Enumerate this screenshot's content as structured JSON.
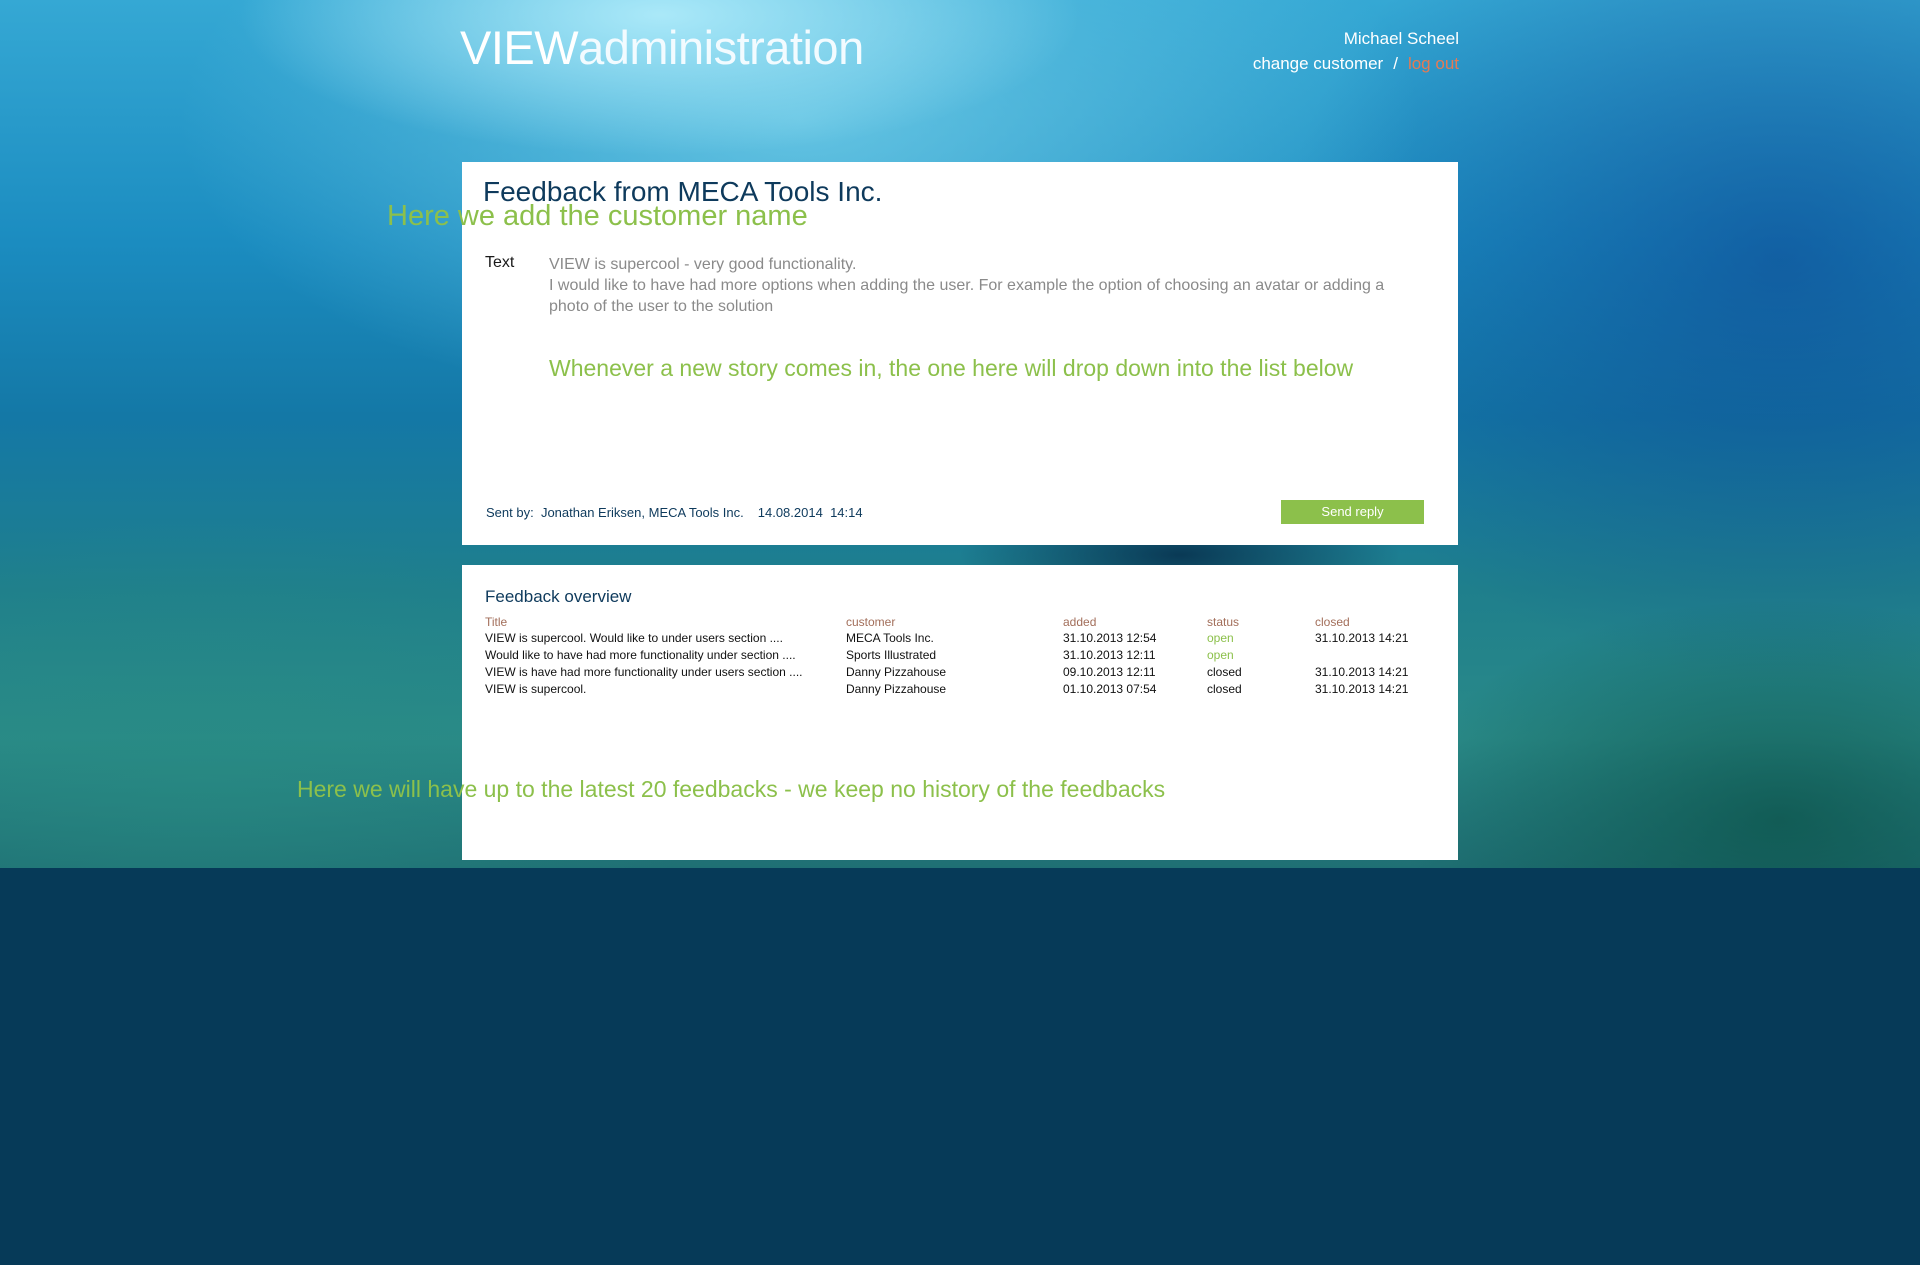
{
  "header": {
    "logo_bold": "VIEW",
    "logo_light": "administration",
    "user_name": "Michael Scheel",
    "change_customer": "change customer",
    "separator": "/",
    "logout": "log out"
  },
  "feedback": {
    "title": "Feedback from MECA Tools Inc.",
    "text_label": "Text",
    "text_lines": [
      "VIEW is supercool - very good functionality.",
      "I would like to have had more options when adding the user. For example the option of choosing an avatar or adding a",
      "photo of the user to the solution"
    ],
    "sent_by_label": "Sent by:",
    "sent_by": "Jonathan Eriksen, MECA Tools Inc.",
    "sent_date": "14.08.2014",
    "sent_time": "14:14",
    "reply_button": "Send reply"
  },
  "overview": {
    "title": "Feedback overview",
    "columns": [
      "Title",
      "customer",
      "added",
      "status",
      "closed"
    ],
    "rows": [
      {
        "title": "VIEW is supercool. Would like to under users section ....",
        "customer": "MECA Tools Inc.",
        "added": "31.10.2013  12:54",
        "status": "open",
        "closed": "31.10.2013  14:21"
      },
      {
        "title": "Would like to have had more functionality under section ....",
        "customer": "Sports Illustrated",
        "added": "31.10.2013  12:11",
        "status": "open",
        "closed": ""
      },
      {
        "title": "VIEW is have had more functionality under users section ....",
        "customer": "Danny Pizzahouse",
        "added": "09.10.2013  12:11",
        "status": "closed",
        "closed": "31.10.2013  14:21"
      },
      {
        "title": "VIEW is supercool.",
        "customer": "Danny Pizzahouse",
        "added": "01.10.2013  07:54",
        "status": "closed",
        "closed": "31.10.2013  14:21"
      }
    ]
  },
  "annotations": {
    "customer_name": "Here we add the customer name",
    "story_drop": "Whenever a new story comes in, the one here will drop down into the list below",
    "history": "Here we will have up to the latest 20 feedbacks - we keep no history of the feedbacks"
  },
  "colors": {
    "accent_green": "#8cc04b",
    "logout_orange": "#e57a53",
    "title_navy": "#0e3a5c",
    "column_header_brown": "#a26e5a",
    "page_bottom": "#063a58"
  }
}
